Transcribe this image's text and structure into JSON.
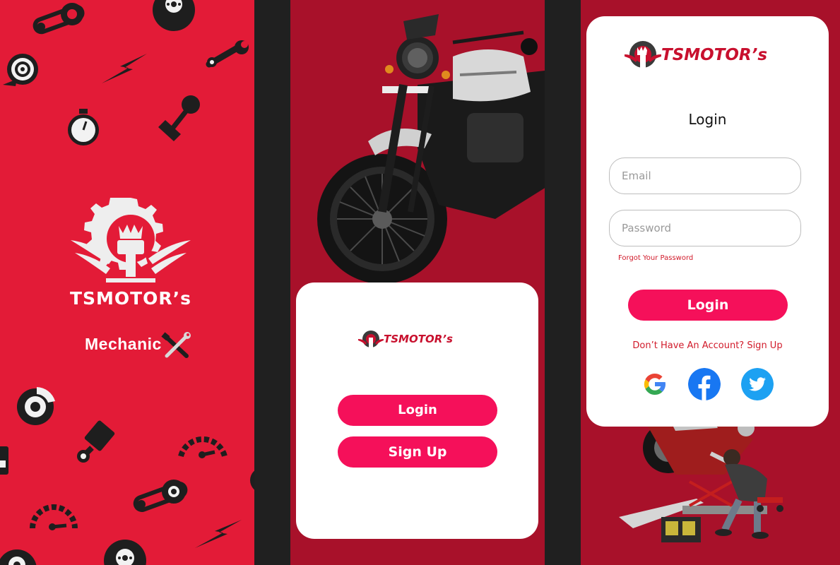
{
  "brand": {
    "name": "TSMOTOR’s",
    "tagline": "Mechanic"
  },
  "colors": {
    "splash_red": "#e31b37",
    "dark_red": "#a8112a",
    "button_pink": "#f5105a",
    "link_red": "#d11a2a"
  },
  "welcome": {
    "login_label": "Login",
    "signup_label": "Sign Up"
  },
  "login": {
    "title": "Login",
    "email_placeholder": "Email",
    "password_placeholder": "Password",
    "forgot_label": "Forgot Your Password",
    "submit_label": "Login",
    "signup_prompt": "Don’t Have An Account? Sign Up",
    "social": [
      "google-icon",
      "facebook-icon",
      "twitter-icon"
    ]
  }
}
